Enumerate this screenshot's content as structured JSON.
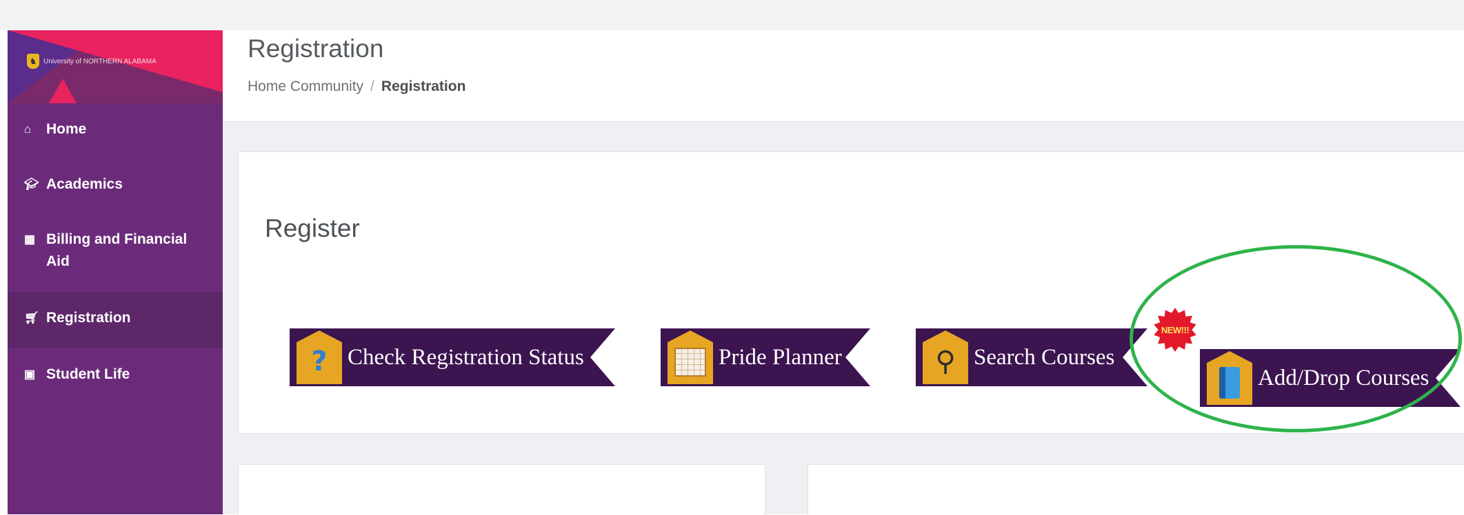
{
  "brand": {
    "logo_text": "University of NORTHERN ALABAMA"
  },
  "sidebar": {
    "items": [
      {
        "label": "Home",
        "icon": "home-icon"
      },
      {
        "label": "Academics",
        "icon": "graduation-cap-icon"
      },
      {
        "label": "Billing and Financial Aid",
        "icon": "calculator-icon"
      },
      {
        "label": "Registration",
        "icon": "cart-icon",
        "active": true
      },
      {
        "label": "Student Life",
        "icon": "image-icon"
      }
    ]
  },
  "header": {
    "title": "Registration",
    "breadcrumb": [
      {
        "label": "Home Community"
      },
      {
        "label": "Registration"
      }
    ],
    "breadcrumb_sep": "/"
  },
  "register_panel": {
    "title": "Register",
    "buttons": [
      {
        "label": "Check Registration Status",
        "icon": "question-mark-icon"
      },
      {
        "label": "Pride Planner",
        "icon": "calendar-icon"
      },
      {
        "label": "Search Courses",
        "icon": "magnifier-icon"
      },
      {
        "label": "Add/Drop Courses",
        "icon": "book-icon",
        "badge": "NEW!!!"
      }
    ]
  },
  "colors": {
    "sidebar": "#6b2b7a",
    "sidebar_active": "#5d2769",
    "ribbon": "#3c1450",
    "badge": "#e6a623",
    "highlight": "#2eb34a",
    "new_badge": "#e3192b"
  }
}
